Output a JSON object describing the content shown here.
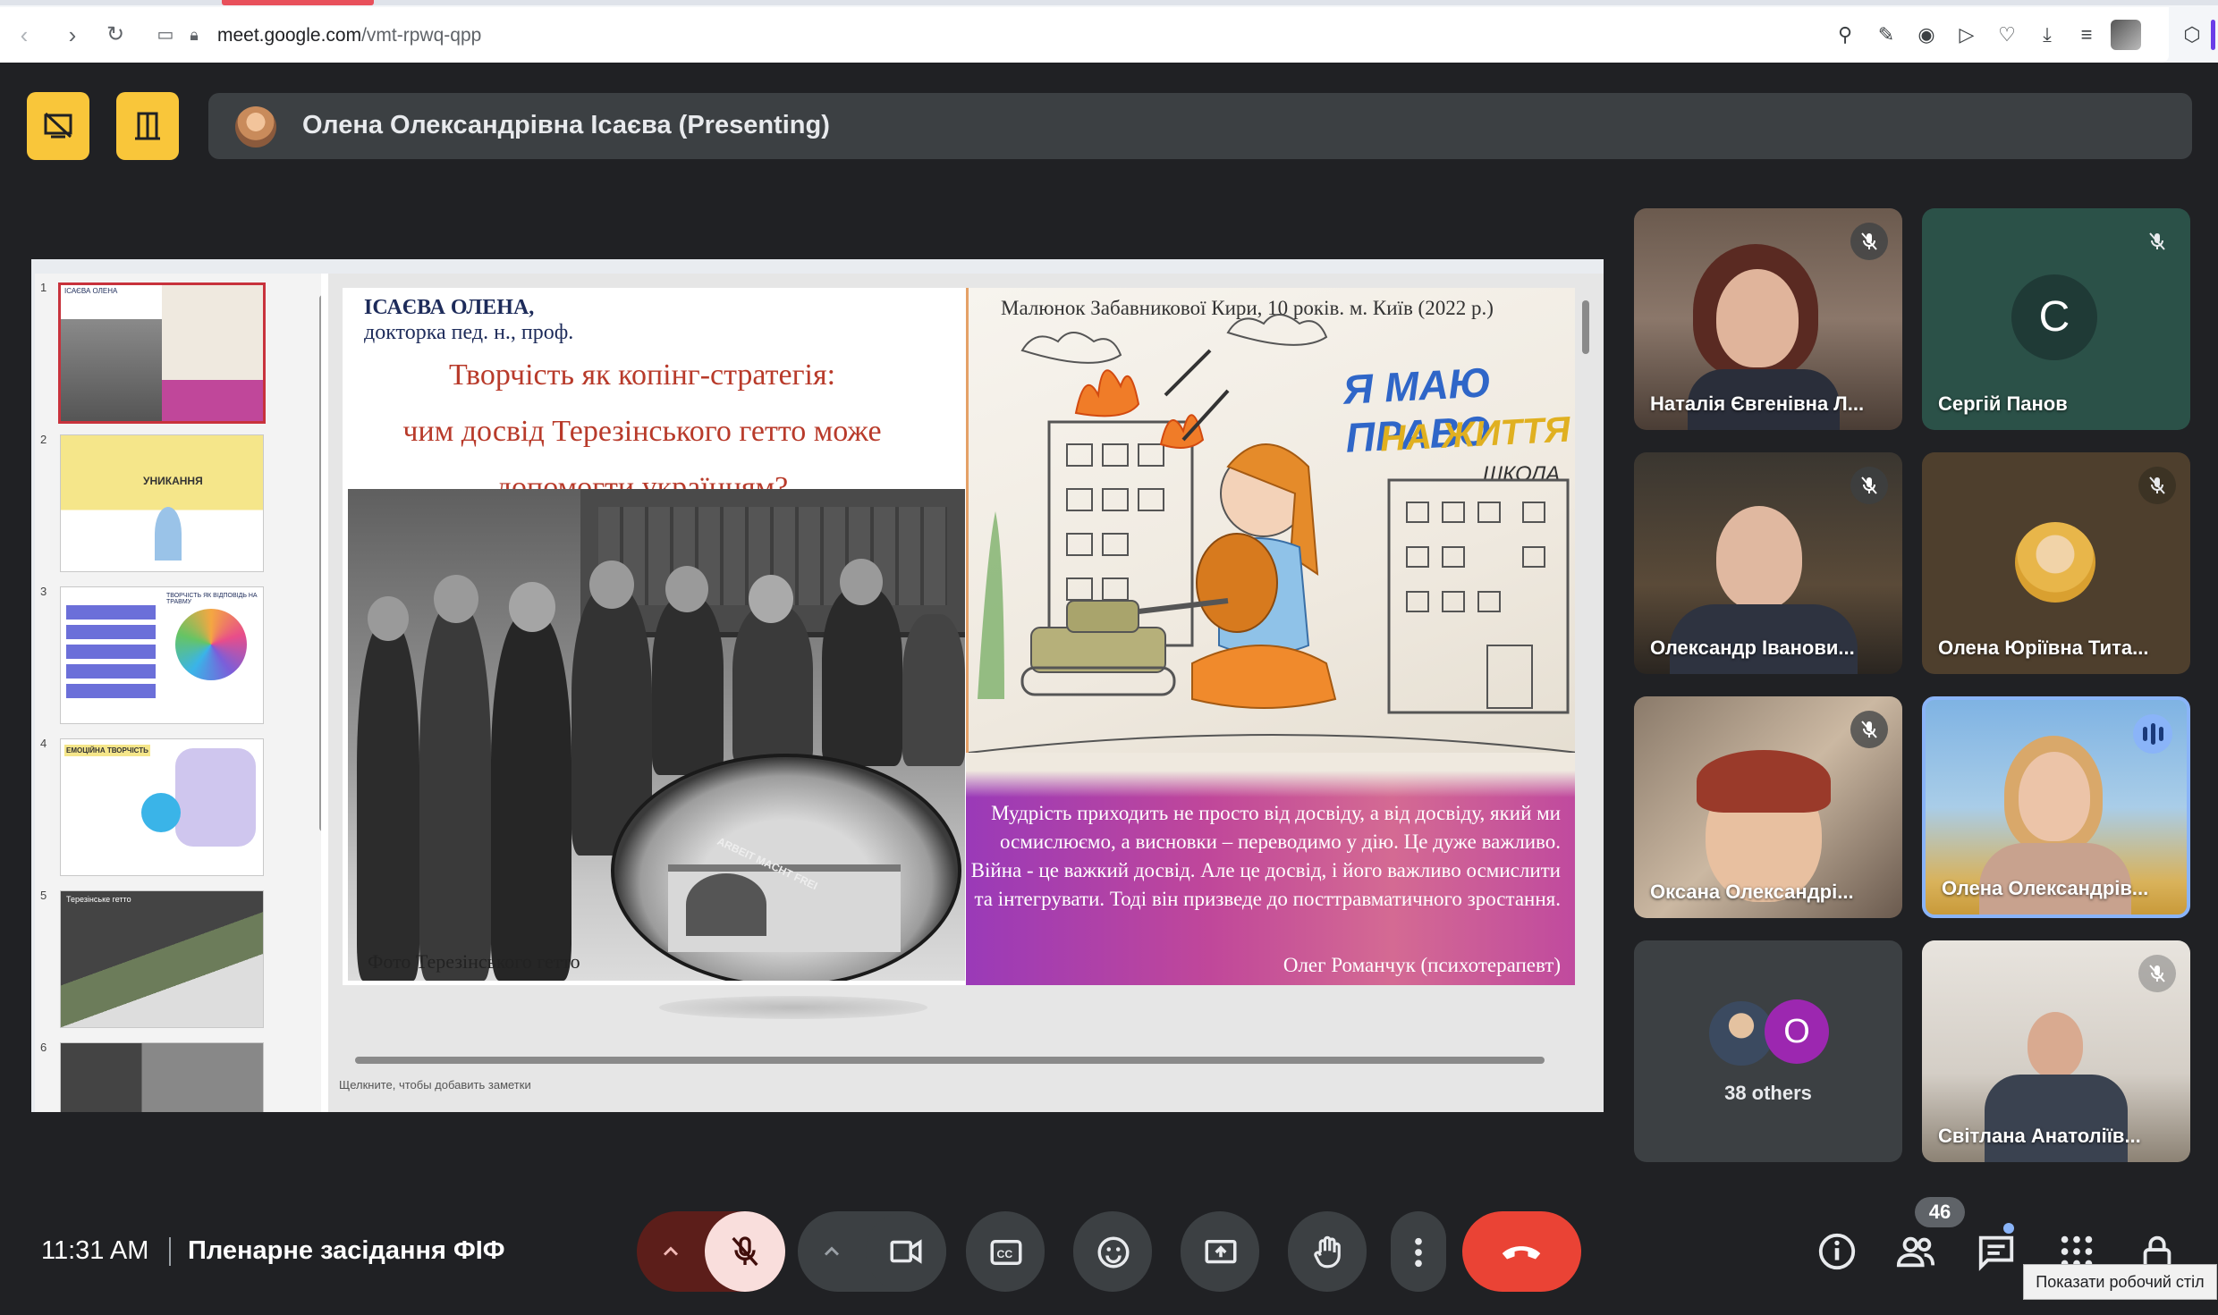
{
  "browser": {
    "url_host": "meet.google.com",
    "url_path": "/vmt-rpwq-qpp"
  },
  "meet": {
    "presenter_label": "Олена Олександрівна Ісаєва (Presenting)",
    "clock": "11:31 AM",
    "meeting_title": "Пленарне засідання ФІФ",
    "participant_count": "46",
    "tooltip": "Показати робочий стіл"
  },
  "slide": {
    "author_name": "ІСАЄВА ОЛЕНА,",
    "author_degree": "докторка пед. н., проф.",
    "title_line1": "Творчість як копінг-стратегія:",
    "title_line2": "чим досвід Терезінського гетто може",
    "title_line3": "допомогти українцям?",
    "photo_caption": "Фото Терезінського гетто",
    "drawing_caption": "Малюнок Забавникової Кири, 10 років. м. Київ (2022 р.)",
    "drawing_text1": "Я МАЮ ПРАВО",
    "drawing_text2": "НА ЖИТТЯ",
    "drawing_text3": "ШКОЛА",
    "quote": "Мудрість приходить не просто від досвіду, а від досвіду, який ми осмислюємо, а висновки – переводимо у дію. Це дуже важливо. Війна - це важкий досвід. Але це досвід, і його важливо осмислити та інтегрувати. Тоді він призведе до посттравматичного зростання.",
    "quote_author": "Олег Романчук (психотерапевт)",
    "notes_placeholder": "Щелкните, чтобы добавить заметки",
    "oval_sign": "ARBEIT MACHT FREI"
  },
  "thumbnails": [
    {
      "num": "1",
      "label": "ІСАЄВА ОЛЕНА"
    },
    {
      "num": "2",
      "label": "УНИКАННЯ"
    },
    {
      "num": "3",
      "label": "ТВОРЧІСТЬ ЯК ВІДПОВІДЬ НА ТРАВМУ"
    },
    {
      "num": "4",
      "label": "ЕМОЦІЙНА ТВОРЧІСТЬ"
    },
    {
      "num": "5",
      "label": "Терезінське гетто"
    },
    {
      "num": "6",
      "label": ""
    }
  ],
  "participants": [
    {
      "name": "Наталія Євгенівна Л...",
      "muted": true
    },
    {
      "name": "Сергій Панов",
      "initial": "C",
      "muted": true
    },
    {
      "name": "Олександр Іванови...",
      "muted": true
    },
    {
      "name": "Олена Юріївна Тита...",
      "muted": true
    },
    {
      "name": "Оксана Олександрі...",
      "muted": true
    },
    {
      "name": "Олена Олександрів...",
      "speaking": true
    },
    {
      "name": "38 others",
      "initial": "O"
    },
    {
      "name": "Світлана Анатоліїв...",
      "muted": true
    }
  ],
  "colors": {
    "meet_bg": "#202124",
    "control_gray": "#3c4043",
    "end_call_red": "#ea4335",
    "presenting_yellow": "#f9c63a",
    "speaking_blue": "#8ab4f8"
  },
  "icons": {
    "present_off": "present-off-icon",
    "exit_layout": "door-icon",
    "mic_off": "mic-off-icon",
    "camera": "camera-icon",
    "captions": "captions-icon",
    "emoji": "emoji-icon",
    "present": "present-screen-icon",
    "hand": "raise-hand-icon",
    "more": "more-vert-icon",
    "end_call": "end-call-icon",
    "info": "info-icon",
    "people": "people-icon",
    "chat": "chat-icon",
    "activities": "apps-icon",
    "lock": "lock-icon"
  }
}
